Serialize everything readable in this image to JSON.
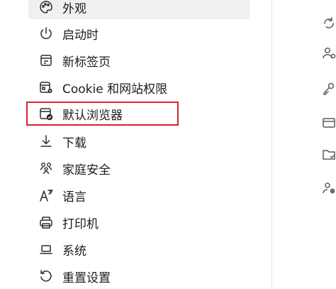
{
  "sidebar": {
    "items": [
      {
        "label": "外观",
        "icon": "palette-icon"
      },
      {
        "label": "启动时",
        "icon": "power-icon"
      },
      {
        "label": "新标签页",
        "icon": "new-tab-icon"
      },
      {
        "label": "Cookie 和网站权限",
        "icon": "site-permissions-icon"
      },
      {
        "label": "默认浏览器",
        "icon": "default-browser-icon"
      },
      {
        "label": "下载",
        "icon": "download-icon"
      },
      {
        "label": "家庭安全",
        "icon": "family-icon"
      },
      {
        "label": "语言",
        "icon": "language-icon"
      },
      {
        "label": "打印机",
        "icon": "printer-icon"
      },
      {
        "label": "系统",
        "icon": "laptop-icon"
      },
      {
        "label": "重置设置",
        "icon": "reset-icon"
      }
    ],
    "selected_index": 0,
    "highlighted_index": 4
  },
  "right_strip": {
    "icons": [
      "sync-icon",
      "profile-icon",
      "key-icon",
      "card-icon",
      "folder-icon",
      "people-gear-icon"
    ]
  },
  "colors": {
    "highlight_border": "#d9232d",
    "selected_background": "#f0f0f0",
    "icon_stroke": "#2b2b2b"
  }
}
